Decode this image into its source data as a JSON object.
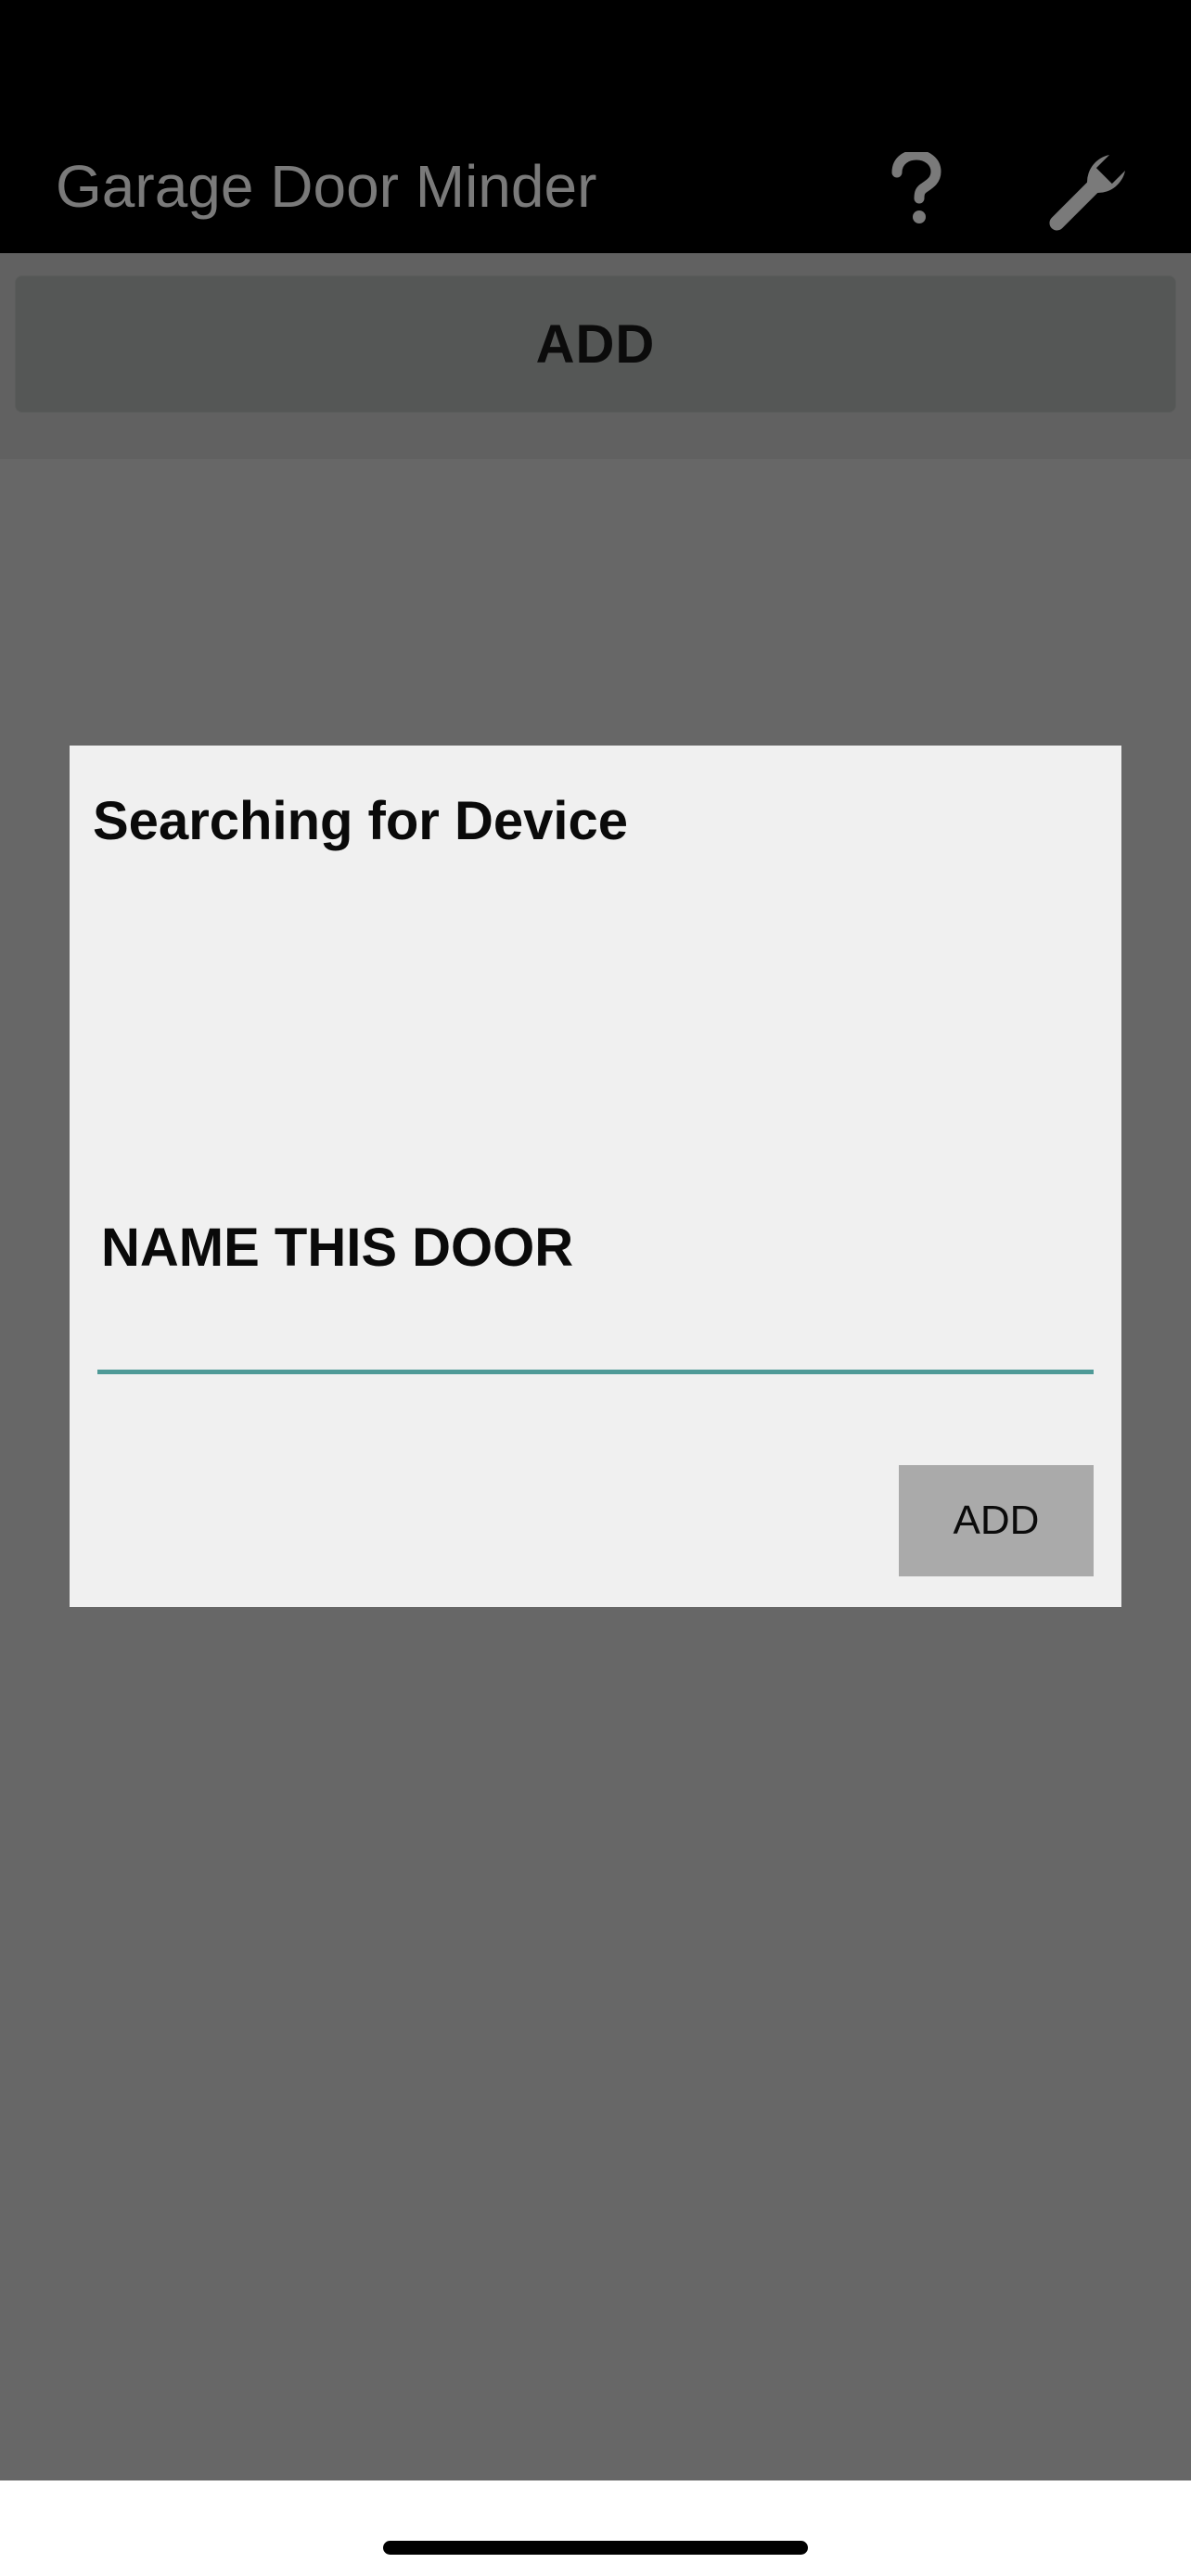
{
  "header": {
    "title": "Garage Door Minder",
    "help_icon": "question-mark-icon",
    "settings_icon": "wrench-icon"
  },
  "toolbar": {
    "add_label": "ADD"
  },
  "dialog": {
    "title": "Searching for Device",
    "name_label": "NAME THIS DOOR",
    "name_value": "",
    "add_label": "ADD"
  },
  "colors": {
    "status_bar": "#000000",
    "app_bar": "#000000",
    "title_text": "#7a7a7a",
    "overlay": "#676767",
    "dialog_bg": "#f0f0f0",
    "input_underline": "#4f9a97",
    "dialog_button_bg": "#aaaaaa"
  }
}
